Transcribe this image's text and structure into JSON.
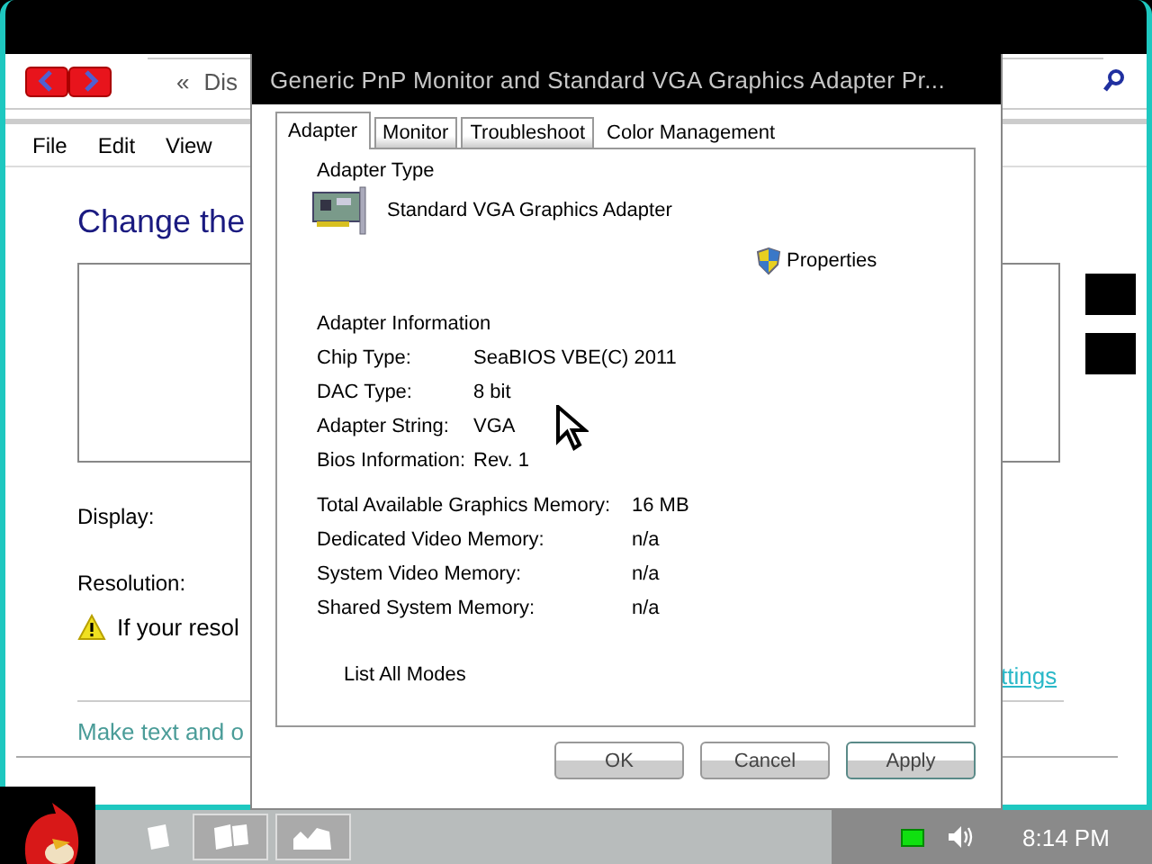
{
  "back_window": {
    "address_chevron": "«",
    "address_text": "Dis",
    "menu": [
      "File",
      "Edit",
      "View"
    ],
    "heading": "Change the",
    "display_label": "Display:",
    "resolution_label": "Resolution:",
    "warning": "If your resol",
    "settings_link": "ttings",
    "text_link": "Make text and o"
  },
  "dialog": {
    "title": "Generic PnP Monitor and Standard VGA Graphics Adapter Pr...",
    "tabs": [
      {
        "label": "Adapter",
        "selected": true
      },
      {
        "label": "Monitor",
        "selected": false
      },
      {
        "label": "Troubleshoot",
        "selected": false
      },
      {
        "label": "Color Management",
        "selected": false
      }
    ],
    "adapter_type_heading": "Adapter Type",
    "adapter_name": "Standard VGA Graphics Adapter",
    "properties_button": "Properties",
    "info_heading": "Adapter Information",
    "info": [
      {
        "label": "Chip Type:",
        "value": "SeaBIOS VBE(C) 2011"
      },
      {
        "label": "DAC Type:",
        "value": "8 bit"
      },
      {
        "label": "Adapter String:",
        "value": "VGA"
      },
      {
        "label": "Bios Information:",
        "value": "Rev. 1"
      }
    ],
    "memory": [
      {
        "label": "Total Available Graphics Memory:",
        "value": "16 MB"
      },
      {
        "label": "Dedicated Video Memory:",
        "value": "n/a"
      },
      {
        "label": "System Video Memory:",
        "value": "n/a"
      },
      {
        "label": "Shared System Memory:",
        "value": "n/a"
      }
    ],
    "list_modes_button": "List All Modes",
    "buttons": [
      "OK",
      "Cancel",
      "Apply"
    ]
  },
  "taskbar": {
    "time": "8:14 PM"
  }
}
